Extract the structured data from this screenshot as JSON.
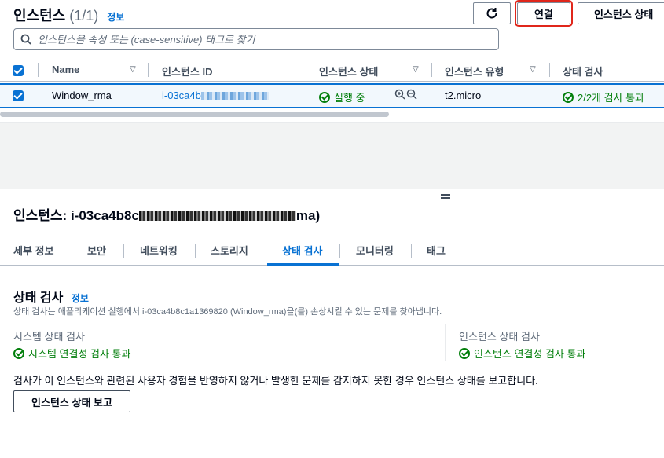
{
  "header": {
    "title": "인스턴스",
    "count": "(1/1)",
    "info": "정보",
    "refresh_icon": "refresh-icon",
    "connect_label": "연결",
    "state_label": "인스턴스 상태"
  },
  "search": {
    "placeholder": "인스턴스을 속성 또는 (case-sensitive) 태그로 찾기",
    "icon": "search-icon"
  },
  "table": {
    "columns": [
      "Name",
      "인스턴스 ID",
      "인스턴스 상태",
      "인스턴스 유형",
      "상태 검사"
    ],
    "rows": [
      {
        "name": "Window_rma",
        "instance_id": "i-03ca4b",
        "state": "실행 중",
        "type": "t2.micro",
        "check": "2/2개 검사 통과"
      }
    ]
  },
  "detail": {
    "title_prefix": "인스턴스: i-03ca4b8c",
    "title_suffix": "ma)",
    "tabs": [
      "세부 정보",
      "보안",
      "네트워킹",
      "스토리지",
      "상태 검사",
      "모니터링",
      "태그"
    ],
    "active_tab": "상태 검사",
    "section_title": "상태 검사",
    "section_info": "정보",
    "description": "상태 검사는 애플리케이션 실행에서 i-03ca4b8c1a1369820 (Window_rma)을(를) 손상시킬 수 있는 문제를 찾아냅니다.",
    "system_check_label": "시스템 상태 검사",
    "system_check_value": "시스템 연결성 검사 통과",
    "instance_check_label": "인스턴스 상태 검사",
    "instance_check_value": "인스턴스 연결성 검사 통과",
    "note": "검사가 이 인스턴스와 관련된 사용자 경험을 반영하지 않거나 발생한 문제를 감지하지 못한 경우 인스턴스 상태를 보고합니다.",
    "report_button": "인스턴스 상태 보고"
  },
  "colors": {
    "accent": "#0972d3",
    "success": "#037f0c",
    "highlight_border": "#e0261b"
  }
}
